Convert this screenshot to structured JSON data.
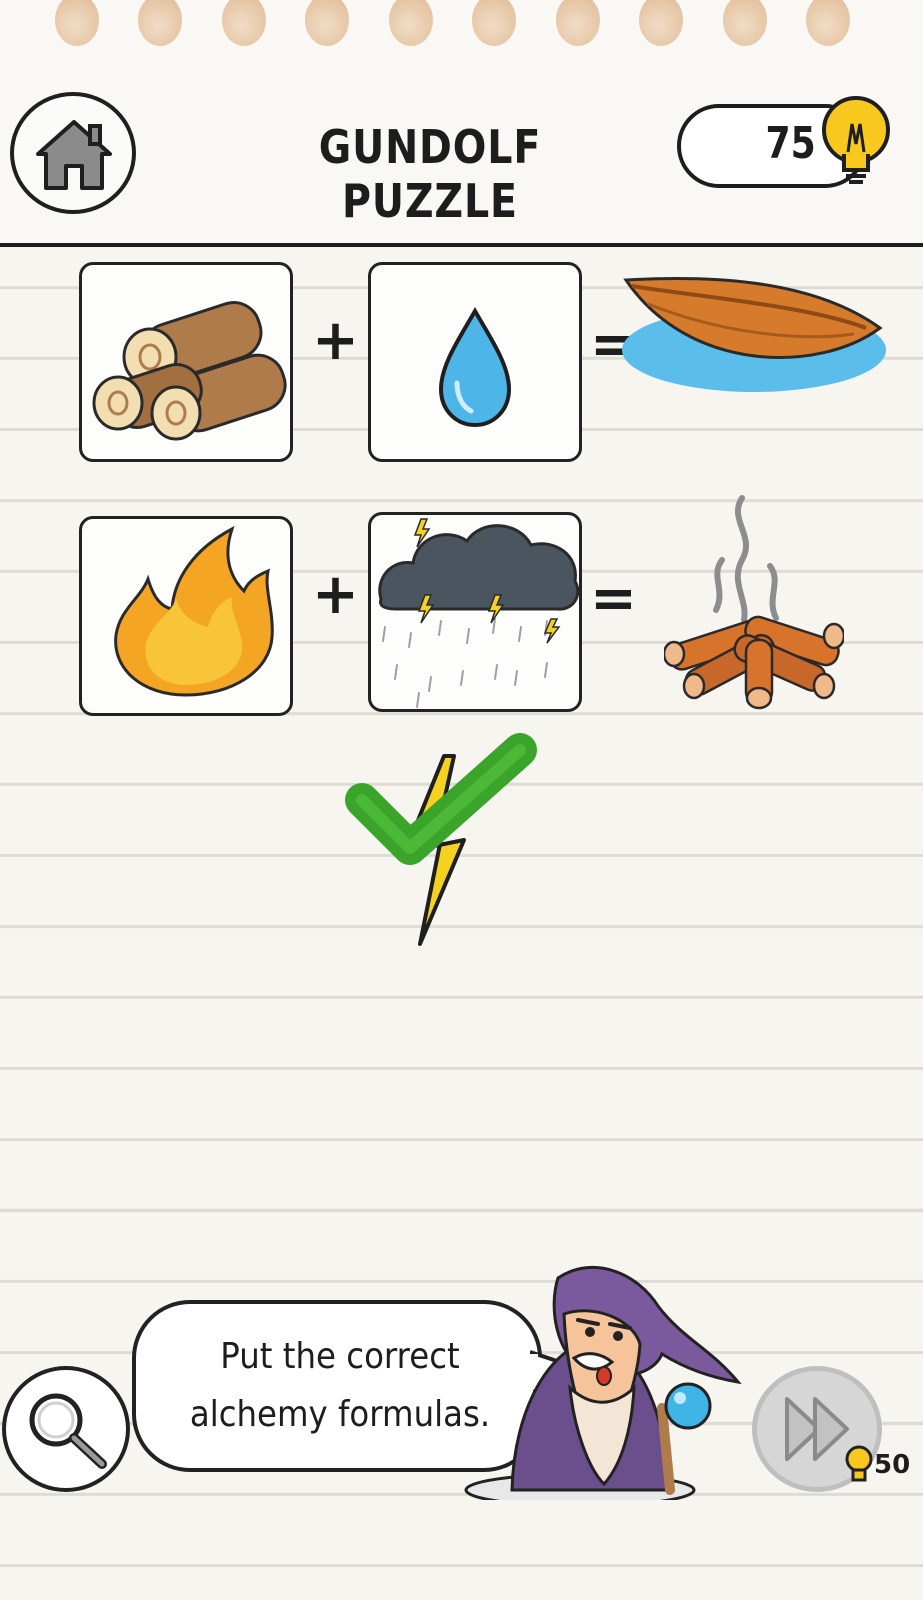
{
  "header": {
    "title": "GUNDOLF PUZZLE",
    "hint_count": "75"
  },
  "formulas": [
    {
      "left": "logs",
      "operator": "+",
      "right": "water drop",
      "equals": "=",
      "result": "boat"
    },
    {
      "left": "fire",
      "operator": "+",
      "right": "storm cloud",
      "equals": "=",
      "result": "campfire"
    }
  ],
  "feedback": {
    "status": "correct",
    "item": "lightning bolt"
  },
  "footer": {
    "bubble_line1": "Put the correct",
    "bubble_line2": "alchemy formulas.",
    "skip_cost": "50"
  },
  "colors": {
    "check_green": "#3aa52a",
    "bolt_yellow": "#f4d21f",
    "wizard_robe": "#6b4f8c"
  }
}
